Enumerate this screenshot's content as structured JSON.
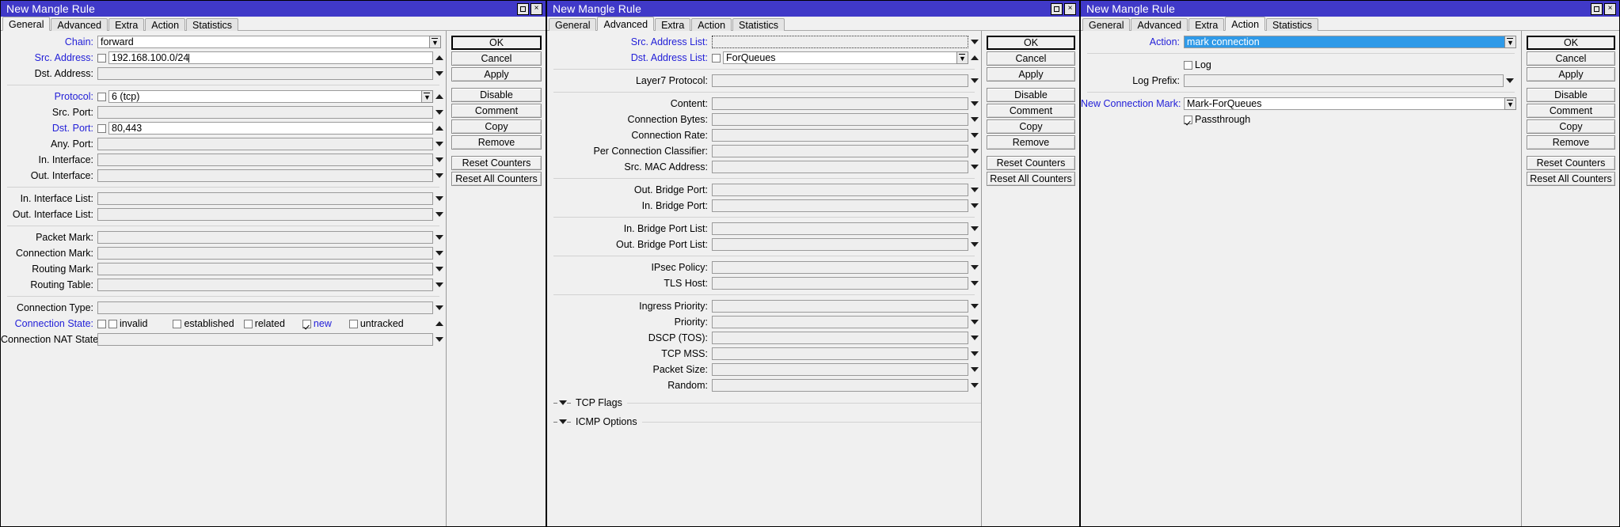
{
  "window_title": "New Mangle Rule",
  "tabs": [
    "General",
    "Advanced",
    "Extra",
    "Action",
    "Statistics"
  ],
  "titlebar_buttons": {
    "maximize": "maximize-icon",
    "close": "×"
  },
  "buttons": {
    "ok": "OK",
    "cancel": "Cancel",
    "apply": "Apply",
    "disable": "Disable",
    "comment": "Comment",
    "copy": "Copy",
    "remove": "Remove",
    "reset_counters": "Reset Counters",
    "reset_all_counters": "Reset All Counters"
  },
  "window1": {
    "title": "New Mangle Rule",
    "active_tab": "General",
    "fields": {
      "chain": {
        "label": "Chain:",
        "value": "forward"
      },
      "src_address": {
        "label": "Src. Address:",
        "value": "192.168.100.0/24",
        "checked": false
      },
      "dst_address": {
        "label": "Dst. Address:",
        "value": ""
      },
      "protocol": {
        "label": "Protocol:",
        "value": "6 (tcp)",
        "checked": false
      },
      "src_port": {
        "label": "Src. Port:",
        "value": ""
      },
      "dst_port": {
        "label": "Dst. Port:",
        "value": "80,443",
        "checked": false
      },
      "any_port": {
        "label": "Any. Port:",
        "value": ""
      },
      "in_interface": {
        "label": "In. Interface:",
        "value": ""
      },
      "out_interface": {
        "label": "Out. Interface:",
        "value": ""
      },
      "in_interface_list": {
        "label": "In. Interface List:",
        "value": ""
      },
      "out_interface_list": {
        "label": "Out. Interface List:",
        "value": ""
      },
      "packet_mark": {
        "label": "Packet Mark:",
        "value": ""
      },
      "connection_mark": {
        "label": "Connection Mark:",
        "value": ""
      },
      "routing_mark": {
        "label": "Routing Mark:",
        "value": ""
      },
      "routing_table": {
        "label": "Routing Table:",
        "value": ""
      },
      "connection_type": {
        "label": "Connection Type:",
        "value": ""
      },
      "connection_state": {
        "label": "Connection State:",
        "options": [
          {
            "label": "invalid",
            "checked": false
          },
          {
            "label": "established",
            "checked": false
          },
          {
            "label": "related",
            "checked": false
          },
          {
            "label": "new",
            "checked": true
          },
          {
            "label": "untracked",
            "checked": false
          }
        ]
      },
      "connection_nat_state": {
        "label": "Connection NAT State:",
        "value": ""
      }
    }
  },
  "window2": {
    "title": "New Mangle Rule",
    "active_tab": "Advanced",
    "fields": {
      "src_address_list": {
        "label": "Src. Address List:",
        "value": ""
      },
      "dst_address_list": {
        "label": "Dst. Address List:",
        "value": "ForQueues",
        "checked": false
      },
      "layer7_protocol": {
        "label": "Layer7 Protocol:",
        "value": ""
      },
      "content": {
        "label": "Content:",
        "value": ""
      },
      "connection_bytes": {
        "label": "Connection Bytes:",
        "value": ""
      },
      "connection_rate": {
        "label": "Connection Rate:",
        "value": ""
      },
      "per_connection_classifier": {
        "label": "Per Connection Classifier:",
        "value": ""
      },
      "src_mac_address": {
        "label": "Src. MAC Address:",
        "value": ""
      },
      "out_bridge_port": {
        "label": "Out. Bridge Port:",
        "value": ""
      },
      "in_bridge_port": {
        "label": "In. Bridge Port:",
        "value": ""
      },
      "in_bridge_port_list": {
        "label": "In. Bridge Port List:",
        "value": ""
      },
      "out_bridge_port_list": {
        "label": "Out. Bridge Port List:",
        "value": ""
      },
      "ipsec_policy": {
        "label": "IPsec Policy:",
        "value": ""
      },
      "tls_host": {
        "label": "TLS Host:",
        "value": ""
      },
      "ingress_priority": {
        "label": "Ingress Priority:",
        "value": ""
      },
      "priority": {
        "label": "Priority:",
        "value": ""
      },
      "dscp_tos": {
        "label": "DSCP (TOS):",
        "value": ""
      },
      "tcp_mss": {
        "label": "TCP MSS:",
        "value": ""
      },
      "packet_size": {
        "label": "Packet Size:",
        "value": ""
      },
      "random": {
        "label": "Random:",
        "value": ""
      }
    },
    "sections": [
      {
        "label": "TCP Flags"
      },
      {
        "label": "ICMP Options"
      }
    ]
  },
  "window3": {
    "title": "New Mangle Rule",
    "active_tab": "Action",
    "fields": {
      "action": {
        "label": "Action:",
        "value": "mark connection"
      },
      "log": {
        "label": "Log",
        "checked": false
      },
      "log_prefix": {
        "label": "Log Prefix:",
        "value": ""
      },
      "new_connection_mark": {
        "label": "New Connection Mark:",
        "value": "Mark-ForQueues"
      },
      "passthrough": {
        "label": "Passthrough",
        "checked": true
      }
    }
  },
  "colors": {
    "titlebar": "#4039c8",
    "label_blue": "#2320d8",
    "selection_blue": "#2f9ae8",
    "window_bg": "#f0f0f0"
  }
}
